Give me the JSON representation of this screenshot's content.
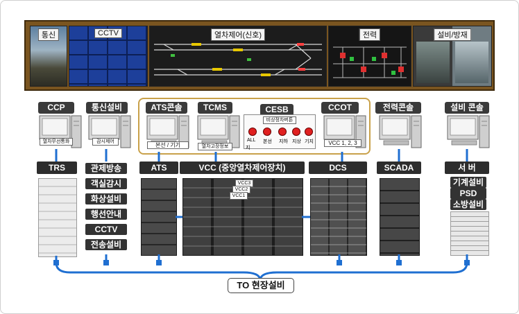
{
  "wall": {
    "comm": "통신",
    "cctv": "CCTV",
    "train_ctrl": "열차제어(신호)",
    "power": "전력",
    "facility": "설비/방재"
  },
  "consoles": {
    "ccp": {
      "title": "CCP",
      "screen": "열차무선통화"
    },
    "comm": {
      "title": "통신설비",
      "screen": "감시제어"
    },
    "ats": {
      "title": "ATS콘솔",
      "screen": "본선 / 기기"
    },
    "tcms": {
      "title": "TCMS",
      "screen": "열차고장정보"
    },
    "cesb": {
      "title": "CESB",
      "header": "비상정차버튼",
      "buttons": [
        "ALL",
        "본선",
        "지하",
        "지상",
        "기지"
      ],
      "extra": "지"
    },
    "ccot": {
      "title": "CCOT",
      "screen": "VCC 1, 2, 3"
    },
    "power": {
      "title": "전력콘솔"
    },
    "facility": {
      "title": "설비 콘솔"
    }
  },
  "equipment": {
    "trs": "TRS",
    "comm_list": [
      "관제방송",
      "객실감시",
      "화상설비",
      "행선안내",
      "CCTV",
      "전송설비"
    ],
    "ats": "ATS",
    "vcc": "VCC (중앙열차제어장치)",
    "vcc_sub": [
      "VCC3",
      "VCC2",
      "VCC1"
    ],
    "dcs": "DCS",
    "scada": "SCADA",
    "server": "서 버",
    "server_list": [
      "기계설비",
      "PSD",
      "소방설비"
    ]
  },
  "footer": "TO 현장설비",
  "colors": {
    "accent": "#1f6fd1",
    "highlight": "#c9a14a",
    "wall": "#7a5520",
    "dark": "#333333"
  }
}
